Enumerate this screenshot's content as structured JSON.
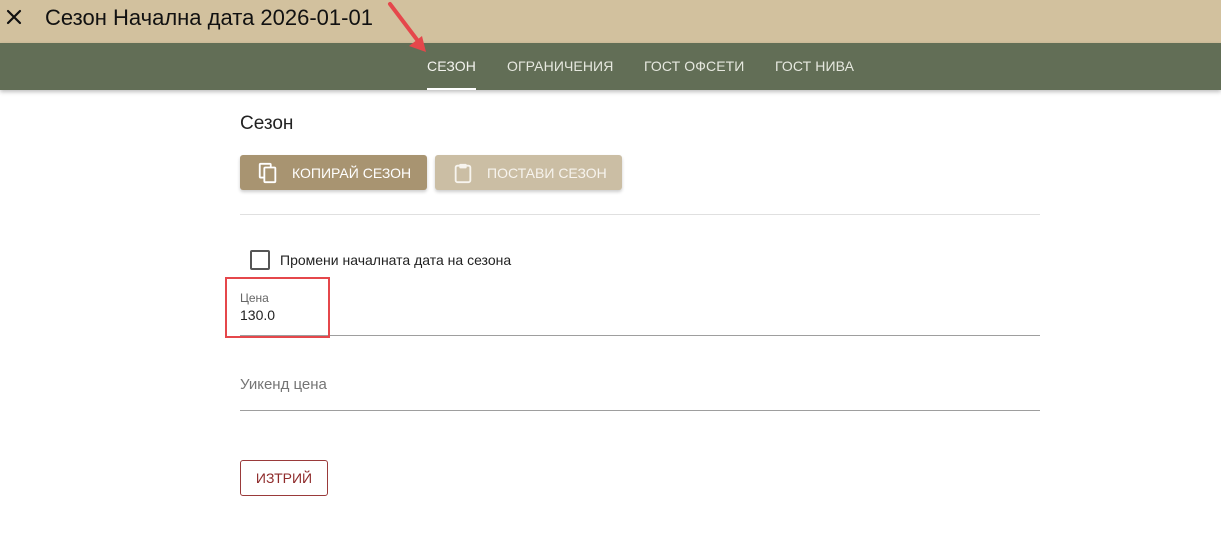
{
  "header": {
    "title": "Сезон Начална дата 2026-01-01",
    "close_icon": "close-icon"
  },
  "tabs": [
    {
      "label": "СЕЗОН",
      "active": true
    },
    {
      "label": "ОГРАНИЧЕНИЯ",
      "active": false
    },
    {
      "label": "ГОСТ ОФСЕТИ",
      "active": false
    },
    {
      "label": "ГОСТ НИВА",
      "active": false
    }
  ],
  "section": {
    "title": "Сезон",
    "copy_button": "КОПИРАЙ СЕЗОН",
    "copy_icon": "copy-icon",
    "paste_button": "ПОСТАВИ СЕЗОН",
    "paste_icon": "clipboard-icon"
  },
  "form": {
    "change_start_date_label": "Промени началната дата на сезона",
    "change_start_date_checked": false,
    "price_label": "Цена",
    "price_value": "130.0",
    "weekend_price_placeholder": "Уикенд цена",
    "weekend_price_value": ""
  },
  "actions": {
    "delete_button": "ИЗТРИЙ"
  },
  "colors": {
    "titlebar": "#d2c19e",
    "tabbar": "#626e56",
    "primary_button": "#a89471",
    "secondary_button": "#cbbea4",
    "delete_border": "#9a3a3a",
    "annotation_red": "#e5474b"
  }
}
